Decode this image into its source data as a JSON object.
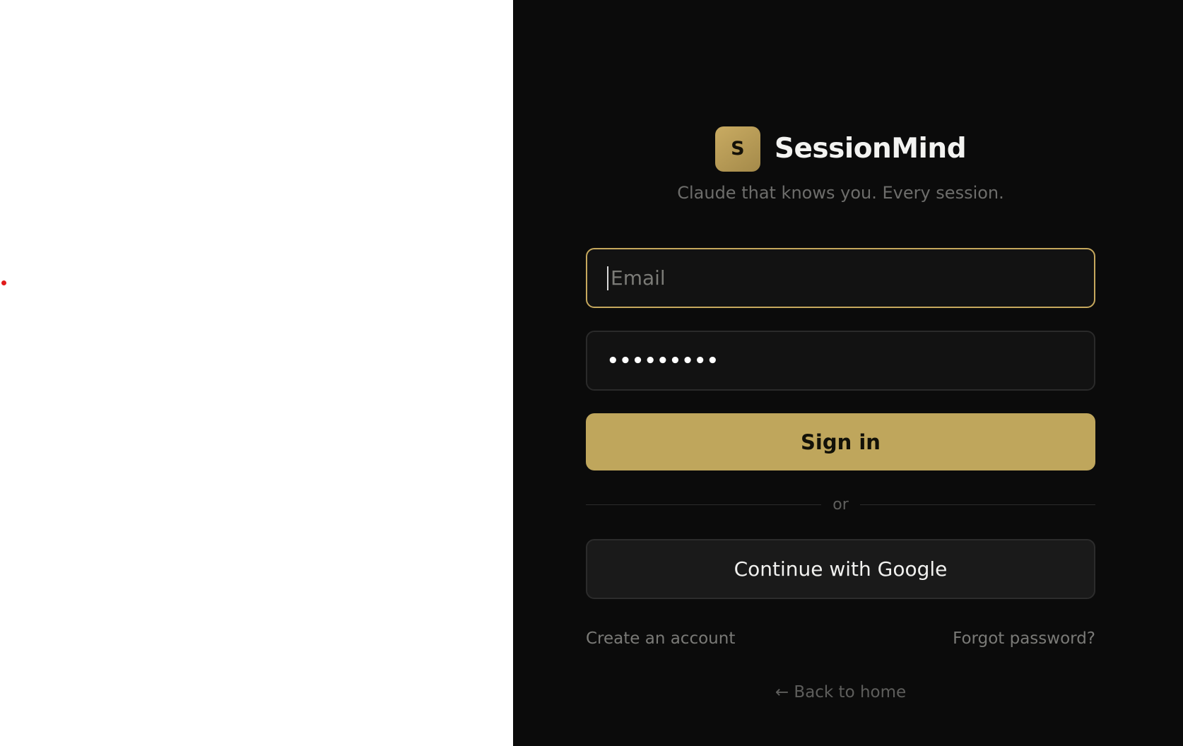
{
  "brand": {
    "logo_letter": "S",
    "name": "SessionMind",
    "tagline": "Claude that knows you. Every session.",
    "accent_color": "#bfa65c"
  },
  "form": {
    "email": {
      "placeholder": "Email",
      "value": ""
    },
    "password": {
      "masked_value": "•••••••••"
    },
    "signin_label": "Sign in",
    "divider_label": "or",
    "google_label": "Continue with Google"
  },
  "links": {
    "create_account": "Create an account",
    "forgot_password": "Forgot password?",
    "back_home": "← Back to home"
  },
  "icons": {
    "cursor": "red-dot-cursor"
  }
}
